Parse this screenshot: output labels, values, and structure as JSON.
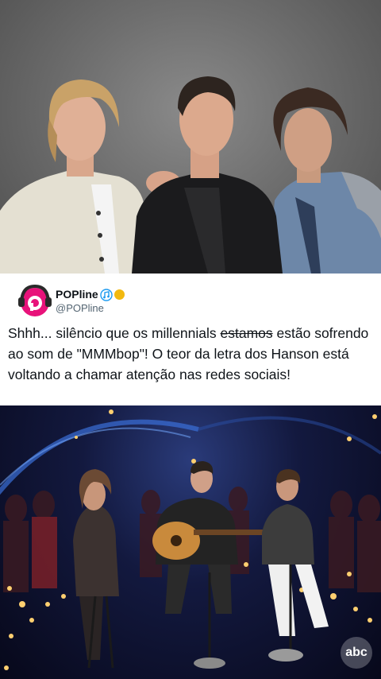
{
  "tweet": {
    "display_name": "POPline",
    "handle": "@POPline",
    "text_before": "Shhh... silêncio que os millennials ",
    "text_struck": "estamos",
    "text_after": " estão sofrendo ao som de \"MMMbop\"! O teor da letra dos Hanson está voltando a chamar atenção nas redes sociais!"
  },
  "video": {
    "channel_logo_text": "abc"
  },
  "colors": {
    "brand_pink": "#e8127a",
    "verified_gold": "#f2b90f",
    "music_badge_blue": "#1d9bf0"
  },
  "icons": [
    "headphones-avatar-icon",
    "music-note-badge-icon",
    "verified-badge-icon",
    "abc-logo-icon"
  ]
}
